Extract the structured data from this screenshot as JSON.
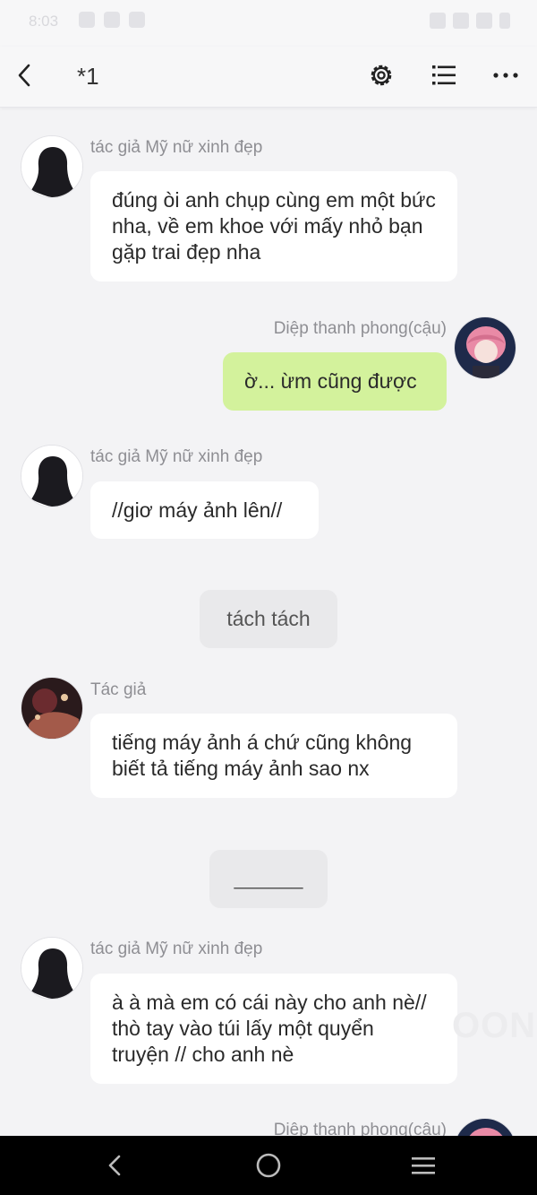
{
  "status_bar": {
    "time": "8:03"
  },
  "app_bar": {
    "title": "*1"
  },
  "messages": [
    {
      "name": "tác giả Mỹ nữ xinh đẹp",
      "text": "đúng òi anh chụp cùng em một bức nha, về em khoe với mấy nhỏ bạn gặp trai đẹp nha"
    },
    {
      "name": "Diệp thanh phong(cậu)",
      "text": "ờ... ừm cũng được"
    },
    {
      "name": "tác giả Mỹ nữ xinh đẹp",
      "text": "//giơ máy ảnh lên//"
    },
    {
      "text": "tách tách"
    },
    {
      "name": "Tác giả",
      "text": "tiếng máy ảnh á chứ cũng không biết tả tiếng máy ảnh sao nx"
    },
    {
      "text": "______"
    },
    {
      "name": "tác giả Mỹ nữ xinh đẹp",
      "text": "à à mà em có cái này cho anh nè// thò tay vào túi lấy một quyển truyện // cho anh nè"
    },
    {
      "name": "Diệp thanh phong(cậu)"
    }
  ],
  "watermark": "OON",
  "colors": {
    "my_bubble": "#d3f29c",
    "other_bubble": "#ffffff",
    "narration": "#e9e9eb",
    "background": "#f3f3f5"
  }
}
